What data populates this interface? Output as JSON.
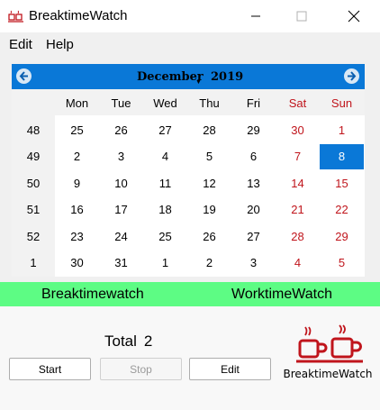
{
  "window": {
    "title": "BreaktimeWatch",
    "app_icon": "cups-icon"
  },
  "menu": {
    "items": [
      {
        "label": "Edit"
      },
      {
        "label": "Help"
      }
    ]
  },
  "calendar": {
    "month": "December",
    "year": "2019",
    "days_of_week": [
      "Mon",
      "Tue",
      "Wed",
      "Thu",
      "Fri",
      "Sat",
      "Sun"
    ],
    "weeks": [
      {
        "week": "48",
        "days": [
          "25",
          "26",
          "27",
          "28",
          "29",
          "30",
          "1"
        ]
      },
      {
        "week": "49",
        "days": [
          "2",
          "3",
          "4",
          "5",
          "6",
          "7",
          "8"
        ]
      },
      {
        "week": "50",
        "days": [
          "9",
          "10",
          "11",
          "12",
          "13",
          "14",
          "15"
        ]
      },
      {
        "week": "51",
        "days": [
          "16",
          "17",
          "18",
          "19",
          "20",
          "21",
          "22"
        ]
      },
      {
        "week": "52",
        "days": [
          "23",
          "24",
          "25",
          "26",
          "27",
          "28",
          "29"
        ]
      },
      {
        "week": "1",
        "days": [
          "30",
          "31",
          "1",
          "2",
          "3",
          "4",
          "5"
        ]
      }
    ],
    "selected_day": "8",
    "colors": {
      "header": "#0a78d7",
      "weekend_red": "#c0151c",
      "selected_bg": "#0a78d7"
    }
  },
  "tabs": {
    "breaktime": "Breaktimewatch",
    "worktime": "WorktimeWatch",
    "strip_color": "#5dfc84"
  },
  "summary": {
    "total_label": "Total",
    "total_value": "2"
  },
  "buttons": {
    "start": "Start",
    "stop": "Stop",
    "edit": "Edit"
  },
  "logo": {
    "text": "BreaktimeWatch",
    "accent": "#c0151c"
  }
}
